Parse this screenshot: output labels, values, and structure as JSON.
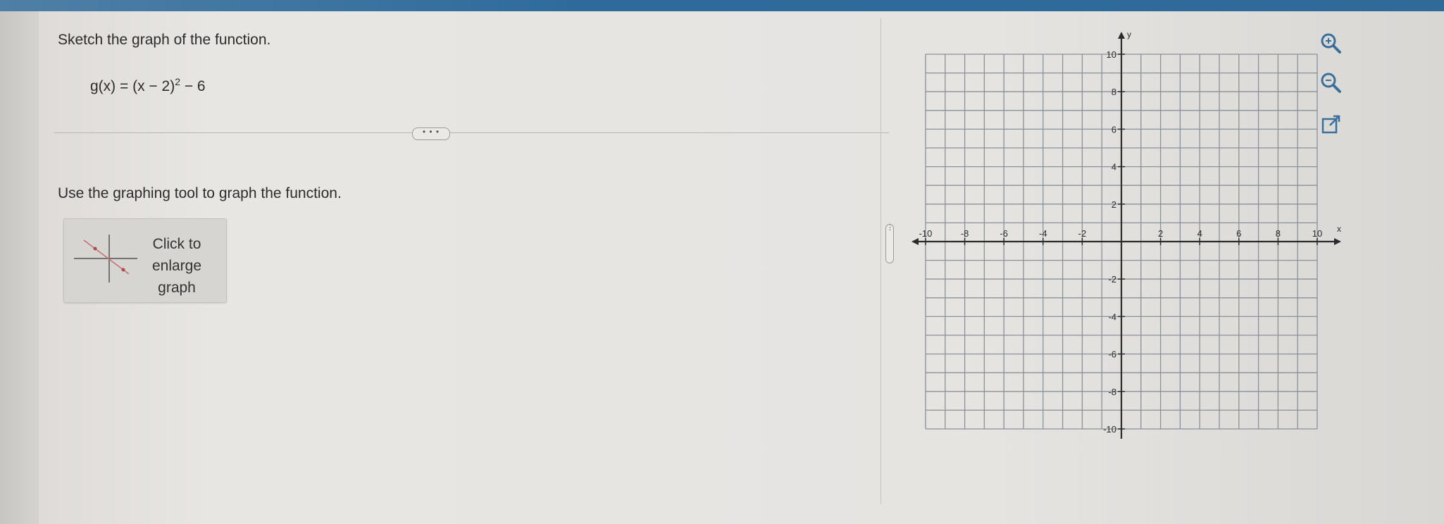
{
  "question": {
    "prompt": "Sketch the graph of the function.",
    "function_name": "g(x) = (x − 2)",
    "function_exponent": "2",
    "function_tail": " − 6",
    "more_button": "• • •",
    "instruction": "Use the graphing tool to graph the function."
  },
  "enlarge_card": {
    "line1": "Click to",
    "line2": "enlarge",
    "line3": "graph"
  },
  "collapse_handle": "⋮",
  "graph": {
    "x_axis_label": "x",
    "y_axis_label": "y",
    "x_min": -10,
    "x_max": 10,
    "y_min": -10,
    "y_max": 10,
    "grid_step": 1,
    "x_tick_labels": [
      "-10",
      "-8",
      "-6",
      "-4",
      "-2",
      "2",
      "4",
      "6",
      "8",
      "10"
    ],
    "y_tick_labels": [
      "10",
      "8",
      "6",
      "4",
      "2",
      "-2",
      "-4",
      "-6",
      "-8",
      "-10"
    ],
    "grid": true
  },
  "tools": {
    "zoom_in": "zoom-in-icon",
    "zoom_out": "zoom-out-icon",
    "popout": "popout-icon"
  },
  "colors": {
    "top_bar": "#2e6b9c",
    "grid_line": "#8a9199",
    "axis": "#2b2b2b",
    "tool_icon": "#3a6f9c"
  }
}
